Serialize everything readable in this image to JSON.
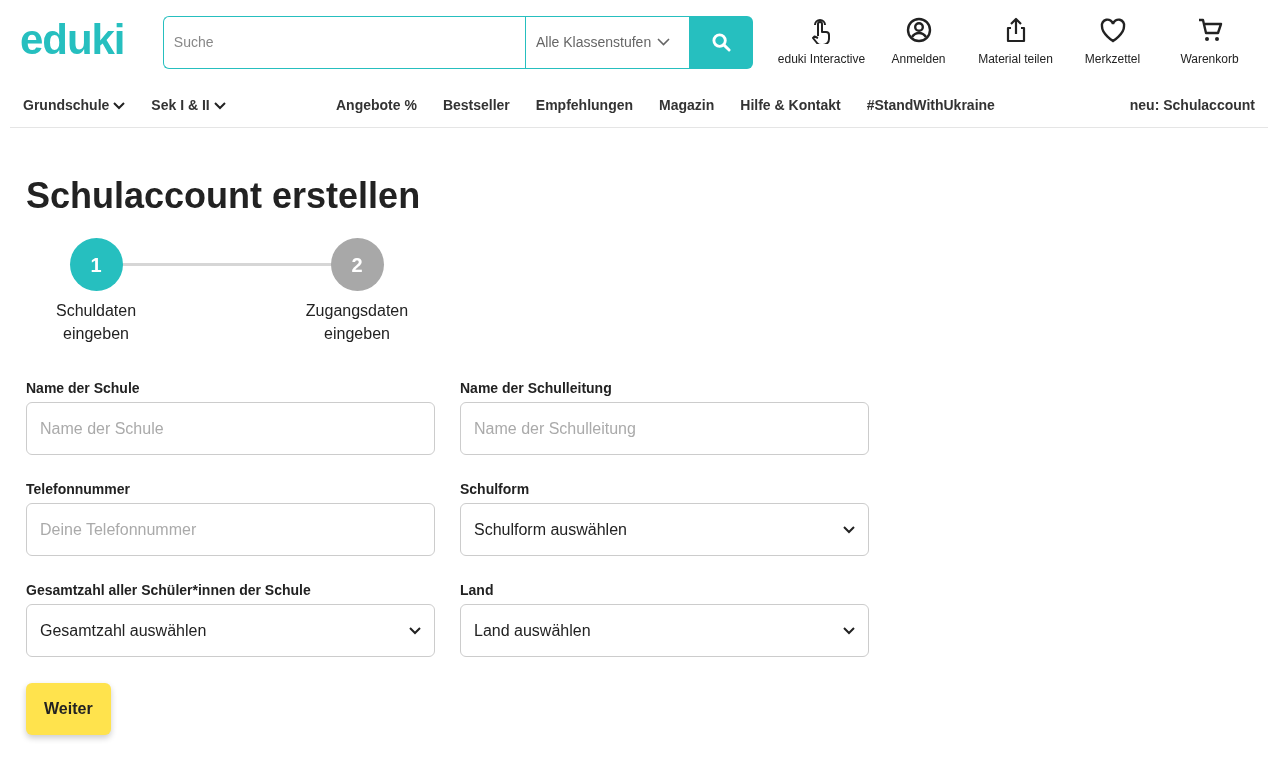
{
  "header": {
    "logo": "eduki",
    "search": {
      "placeholder": "Suche"
    },
    "grade_select": {
      "value": "Alle Klassenstufen"
    },
    "actions": [
      {
        "kind": "touch",
        "label": "eduki Interactive"
      },
      {
        "kind": "user",
        "label": "Anmelden"
      },
      {
        "kind": "share",
        "label": "Material teilen"
      },
      {
        "kind": "heart",
        "label": "Merkzettel"
      },
      {
        "kind": "cart",
        "label": "Warenkorb"
      }
    ]
  },
  "nav": {
    "left": [
      {
        "label": "Grundschule",
        "expandable": true
      },
      {
        "label": "Sek I & II",
        "expandable": true
      }
    ],
    "middle": [
      {
        "label": "Angebote %"
      },
      {
        "label": "Bestseller"
      },
      {
        "label": "Empfehlungen"
      },
      {
        "label": "Magazin"
      },
      {
        "label": "Hilfe & Kontakt"
      },
      {
        "label": "#StandWithUkraine"
      }
    ],
    "right": {
      "label": "neu: Schulaccount"
    }
  },
  "title": "Schulaccount erstellen",
  "steps": [
    {
      "number": "1",
      "label": "Schuldaten eingeben",
      "selected": true
    },
    {
      "number": "2",
      "label": "Zugangsdaten eingeben",
      "selected": false
    }
  ],
  "fields": [
    {
      "kind": "input",
      "label": "Name der Schule",
      "placeholder": "Name der Schule"
    },
    {
      "kind": "input",
      "label": "Name der Schulleitung",
      "placeholder": "Name der Schulleitung"
    },
    {
      "kind": "input",
      "label": "Telefonnummer",
      "placeholder": "Deine Telefonnummer"
    },
    {
      "kind": "select",
      "label": "Schulform",
      "value": "Schulform auswählen"
    },
    {
      "kind": "select",
      "label": "Gesamtzahl aller Schüler*innen der Schule",
      "value": "Gesamtzahl auswählen"
    },
    {
      "kind": "select",
      "label": "Land",
      "value": "Land auswählen"
    }
  ],
  "submit": "Weiter"
}
